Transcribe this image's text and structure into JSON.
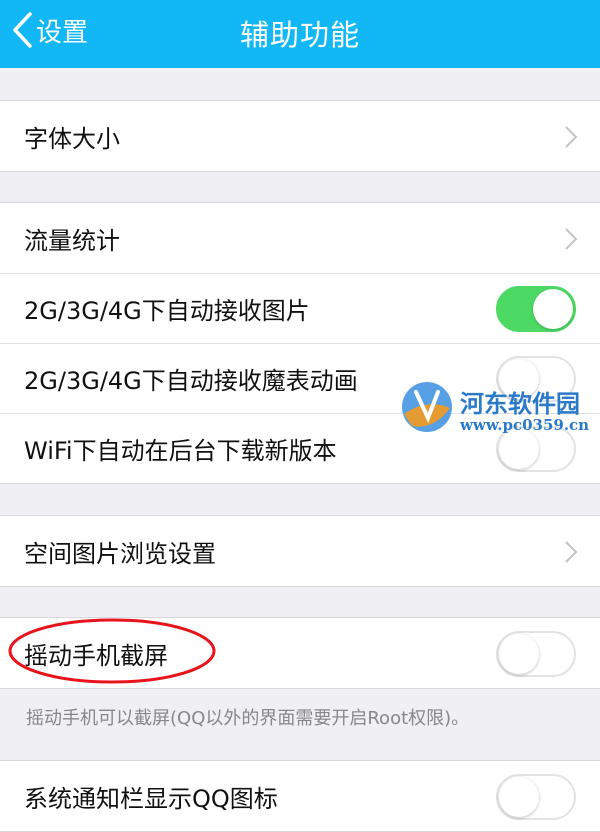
{
  "header": {
    "back_label": "设置",
    "title": "辅助功能"
  },
  "groups": [
    {
      "items": [
        {
          "label": "字体大小",
          "control": "chevron"
        }
      ]
    },
    {
      "items": [
        {
          "label": "流量统计",
          "control": "chevron"
        },
        {
          "label": "2G/3G/4G下自动接收图片",
          "control": "switch",
          "on": true
        },
        {
          "label": "2G/3G/4G下自动接收魔表动画",
          "control": "switch",
          "on": false
        },
        {
          "label": "WiFi下自动在后台下载新版本",
          "control": "switch",
          "on": false
        }
      ]
    },
    {
      "items": [
        {
          "label": "空间图片浏览设置",
          "control": "chevron"
        }
      ]
    },
    {
      "items": [
        {
          "label": "摇动手机截屏",
          "control": "switch",
          "on": false
        }
      ]
    },
    {
      "items": [
        {
          "label": "系统通知栏显示QQ图标",
          "control": "switch",
          "on": false
        }
      ]
    }
  ],
  "shake_note": "摇动手机可以截屏(QQ以外的界面需要开启Root权限)。",
  "watermark": {
    "name": "河东软件园",
    "url": "www.pc0359.cn"
  },
  "colors": {
    "header_bg": "#12b7f5",
    "switch_on": "#4cd964",
    "annotation_circle": "#e8141b"
  }
}
